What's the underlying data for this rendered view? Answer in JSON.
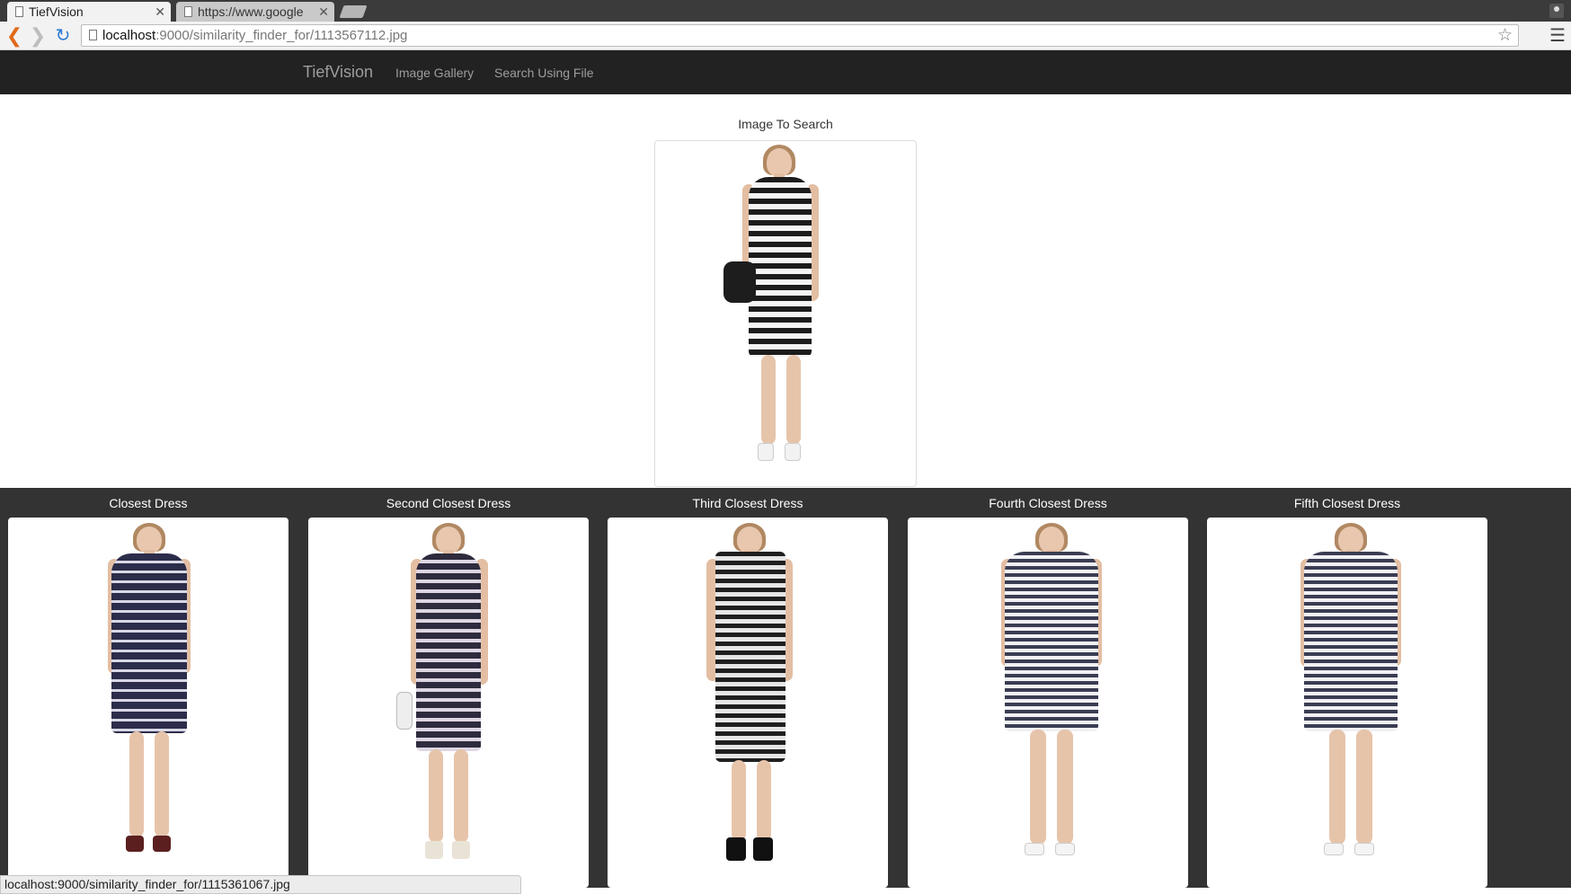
{
  "browser": {
    "tabs": [
      {
        "title": "TiefVision",
        "active": true
      },
      {
        "title": "https://www.google",
        "active": false
      }
    ],
    "address": {
      "host": "localhost",
      "path": ":9000/similarity_finder_for/1113567112.jpg"
    },
    "status_url": "localhost:9000/similarity_finder_for/1115361067.jpg"
  },
  "navbar": {
    "brand": "TiefVision",
    "links": [
      "Image Gallery",
      "Search Using File"
    ]
  },
  "query": {
    "heading": "Image To Search"
  },
  "results": [
    {
      "heading": "Closest Dress",
      "dress_color": "#2b2d4a",
      "stripe_color": "#d9d9e6"
    },
    {
      "heading": "Second Closest Dress",
      "dress_color": "#2e2b3e",
      "stripe_color": "#ded6e3"
    },
    {
      "heading": "Third Closest Dress",
      "dress_color": "#1f1f1f",
      "stripe_color": "#e6e6e6"
    },
    {
      "heading": "Fourth Closest Dress",
      "dress_color": "#3a3d52",
      "stripe_color": "#f1f1f5"
    },
    {
      "heading": "Fifth Closest Dress",
      "dress_color": "#3a3d52",
      "stripe_color": "#f1f1f5"
    }
  ],
  "icons": {
    "back": "back-arrow-icon",
    "forward": "forward-arrow-icon",
    "reload": "reload-icon",
    "star": "bookmark-star-icon",
    "menu": "menu-icon",
    "page": "page-icon",
    "profile": "profile-icon"
  }
}
